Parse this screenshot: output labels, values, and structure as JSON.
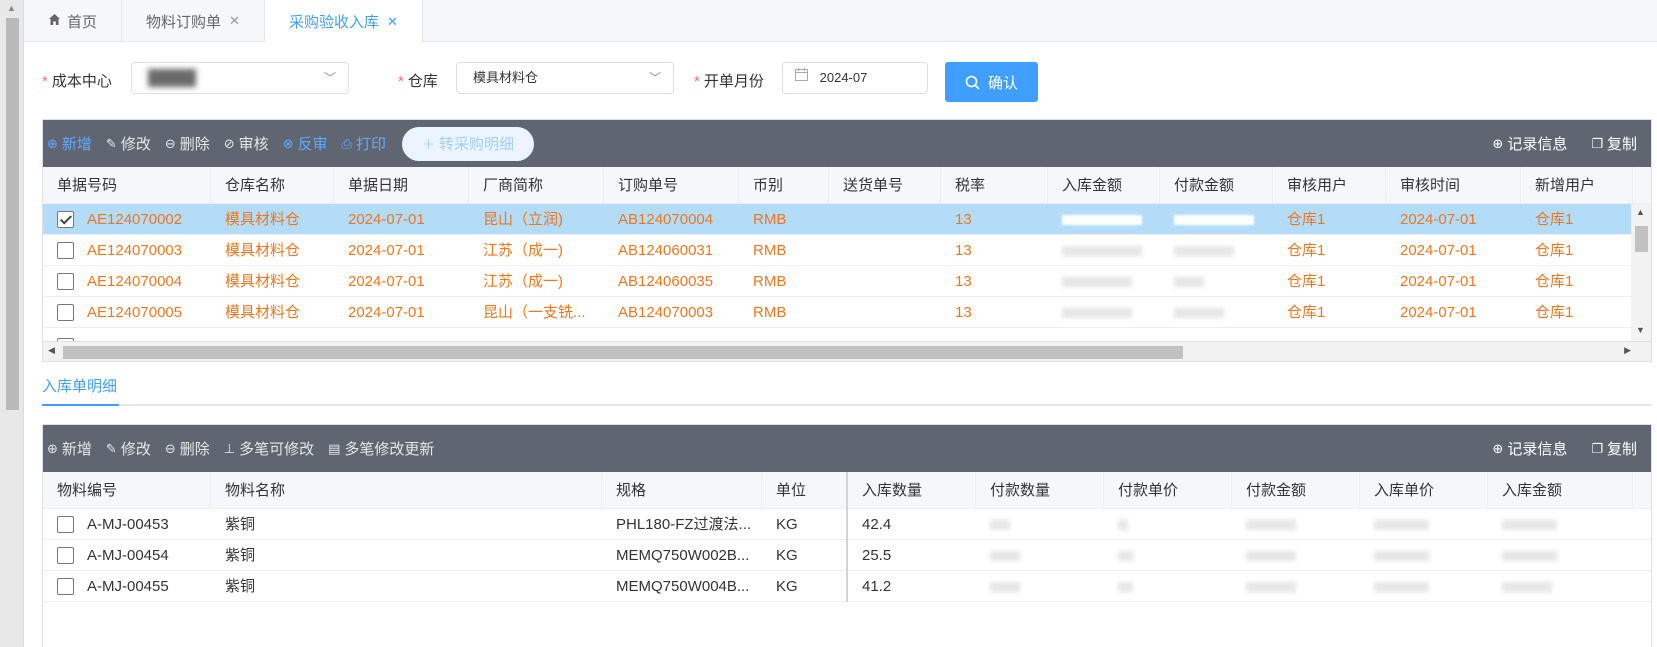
{
  "tabs": [
    {
      "label": "首页",
      "closable": false,
      "active": false
    },
    {
      "label": "物料订购单",
      "closable": true,
      "active": false
    },
    {
      "label": "采购验收入库",
      "closable": true,
      "active": true
    }
  ],
  "filters": {
    "cost_center_label": "成本中心",
    "warehouse_label": "仓库",
    "warehouse_value": "模具材料仓",
    "month_label": "开单月份",
    "month_value": "2024-07",
    "required_mark": "*",
    "confirm_label": "确认"
  },
  "toolbar": {
    "add": "新增",
    "edit": "修改",
    "delete": "删除",
    "approve": "审核",
    "unapprove": "反审",
    "print": "打印",
    "to_detail": "转采购明细",
    "record_info": "记录信息",
    "copy": "复制"
  },
  "grid": {
    "columns": [
      "单据号码",
      "仓库名称",
      "单据日期",
      "厂商简称",
      "订购单号",
      "币别",
      "送货单号",
      "税率",
      "入库金额",
      "付款金额",
      "审核用户",
      "审核时间",
      "新增用户"
    ],
    "rows": [
      {
        "checked": true,
        "no": "AE124070002",
        "warehouse": "模具材料仓",
        "date": "2024-07-01",
        "vendor": "昆山（立润)",
        "order": "AB124070004",
        "currency": "RMB",
        "delivery": "",
        "tax": "13",
        "auditor": "仓库1",
        "audit_time": "2024-07-01",
        "creator": "仓库1"
      },
      {
        "checked": false,
        "no": "AE124070003",
        "warehouse": "模具材料仓",
        "date": "2024-07-01",
        "vendor": "江苏（成一)",
        "order": "AB124060031",
        "currency": "RMB",
        "delivery": "",
        "tax": "13",
        "auditor": "仓库1",
        "audit_time": "2024-07-01",
        "creator": "仓库1"
      },
      {
        "checked": false,
        "no": "AE124070004",
        "warehouse": "模具材料仓",
        "date": "2024-07-01",
        "vendor": "江苏（成一)",
        "order": "AB124060035",
        "currency": "RMB",
        "delivery": "",
        "tax": "13",
        "auditor": "仓库1",
        "audit_time": "2024-07-01",
        "creator": "仓库1"
      },
      {
        "checked": false,
        "no": "AE124070005",
        "warehouse": "模具材料仓",
        "date": "2024-07-01",
        "vendor": "昆山（一支铣...",
        "order": "AB124070003",
        "currency": "RMB",
        "delivery": "",
        "tax": "13",
        "auditor": "仓库1",
        "audit_time": "2024-07-01",
        "creator": "仓库1"
      }
    ]
  },
  "subtab": {
    "label": "入库单明细"
  },
  "detail_toolbar": {
    "add": "新增",
    "edit": "修改",
    "delete": "删除",
    "multi_edit": "多笔可修改",
    "multi_update": "多笔修改更新",
    "record_info": "记录信息",
    "copy": "复制"
  },
  "detail": {
    "columns": [
      "物料编号",
      "物料名称",
      "规格",
      "单位",
      "入库数量",
      "付款数量",
      "付款单价",
      "付款金额",
      "入库单价",
      "入库金额"
    ],
    "rows": [
      {
        "code": "A-MJ-00453",
        "name": "紫铜",
        "spec": "PHL180-FZ过渡法...",
        "unit": "KG",
        "qty": "42.4"
      },
      {
        "code": "A-MJ-00454",
        "name": "紫铜",
        "spec": "MEMQ750W002B...",
        "unit": "KG",
        "qty": "25.5"
      },
      {
        "code": "A-MJ-00455",
        "name": "紫铜",
        "spec": "MEMQ750W004B...",
        "unit": "KG",
        "qty": "41.2"
      }
    ]
  },
  "colors": {
    "accent": "#409eff",
    "toolbar": "#5f6671",
    "row_text": "#f0761e",
    "selected_row": "#b3dcf8"
  }
}
